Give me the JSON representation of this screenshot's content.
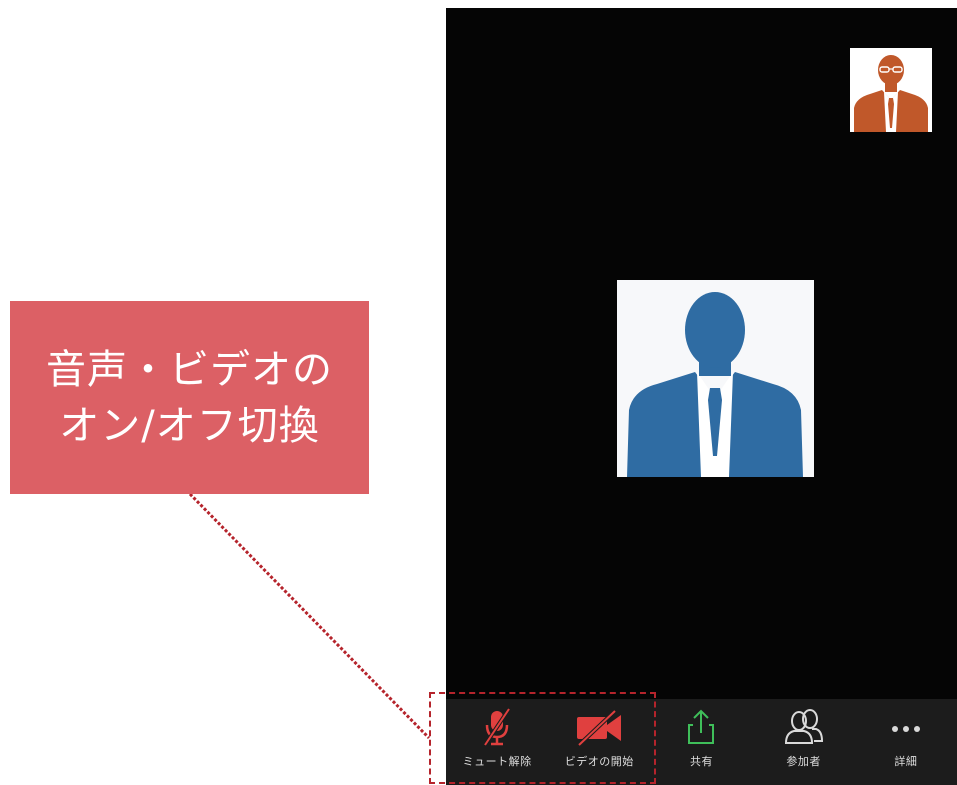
{
  "callout": {
    "line1": "音声・ビデオの",
    "line2": "オン/オフ切換"
  },
  "toolbar": {
    "buttons": [
      {
        "label": "ミュート解除",
        "icon": "microphone-muted-icon",
        "color": "#e0403f"
      },
      {
        "label": "ビデオの開始",
        "icon": "video-camera-off-icon",
        "color": "#e0403f"
      },
      {
        "label": "共有",
        "icon": "share-upload-icon",
        "color": "#3fbf5a"
      },
      {
        "label": "参加者",
        "icon": "participants-icon",
        "color": "#d9d9d9"
      },
      {
        "label": "詳細",
        "icon": "more-dots-icon",
        "color": "#d9d9d9"
      }
    ]
  },
  "colors": {
    "callout_bg": "#dc6065",
    "highlight_border": "#b5242c",
    "screen_bg": "#050505",
    "toolbar_bg": "#1c1c1c",
    "self_avatar": "#c0582a",
    "main_avatar": "#2f6ca3"
  }
}
